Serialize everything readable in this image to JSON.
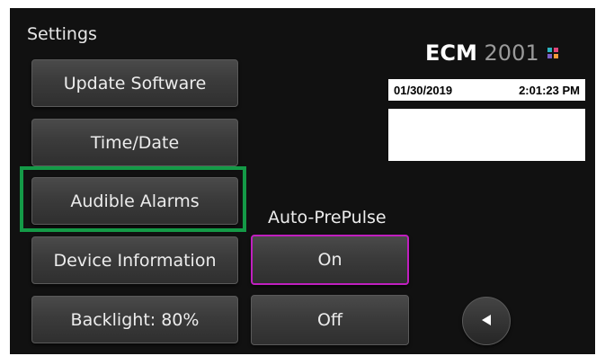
{
  "screen": {
    "title": "Settings"
  },
  "menu": {
    "items": [
      {
        "label": "Update Software"
      },
      {
        "label": "Time/Date"
      },
      {
        "label": "Audible Alarms",
        "highlighted": true
      },
      {
        "label": "Device Information"
      },
      {
        "label": "Backlight: 80%"
      }
    ]
  },
  "auto_prepulse": {
    "label": "Auto-PrePulse",
    "on_label": "On",
    "off_label": "Off",
    "selected": "On"
  },
  "header": {
    "brand": "ECM",
    "model": "2001",
    "date": "01/30/2019",
    "time": "2:01:23 PM"
  },
  "nav": {
    "back_icon": "back-arrow-icon"
  },
  "colors": {
    "background": "#111111",
    "highlight": "#149a47",
    "selected_border": "#c01fbf",
    "logo_mark": [
      "#2bb3c0",
      "#e0457b",
      "#7b5fc7",
      "#f29a3a"
    ]
  }
}
